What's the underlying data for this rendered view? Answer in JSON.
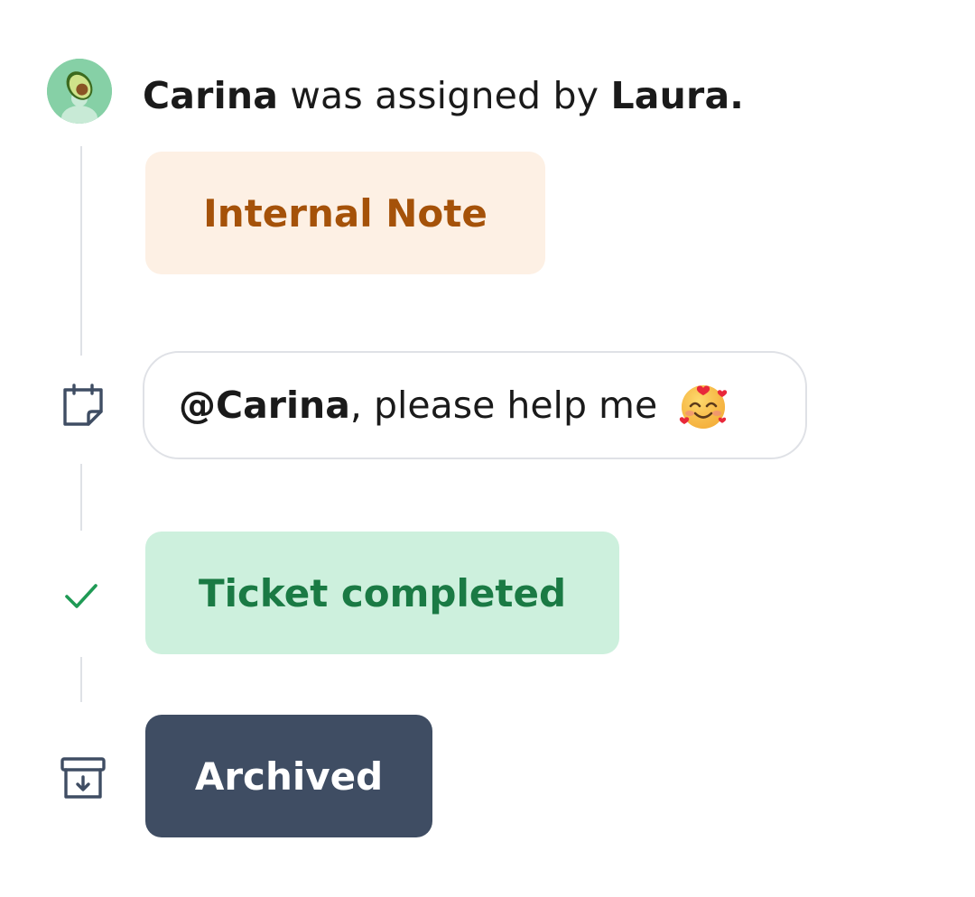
{
  "assignment": {
    "assignee": "Carina",
    "middle_text": " was assigned by ",
    "assigner": "Laura.",
    "avatar_icon": "avocado-avatar-icon"
  },
  "internal_note": {
    "label": "Internal Note",
    "color": "#a55209",
    "background": "#fdf0e4"
  },
  "message": {
    "mention": "@Carina",
    "text": ", please help me",
    "emoji_icon": "smiling-face-with-hearts-emoji",
    "side_icon": "sticky-note-icon"
  },
  "ticket_status": {
    "label": "Ticket completed",
    "color": "#1a7a44",
    "background": "#cdf0dd",
    "side_icon": "check-icon"
  },
  "archive": {
    "label": "Archived",
    "background": "#3f4d63",
    "side_icon": "archive-box-icon"
  }
}
